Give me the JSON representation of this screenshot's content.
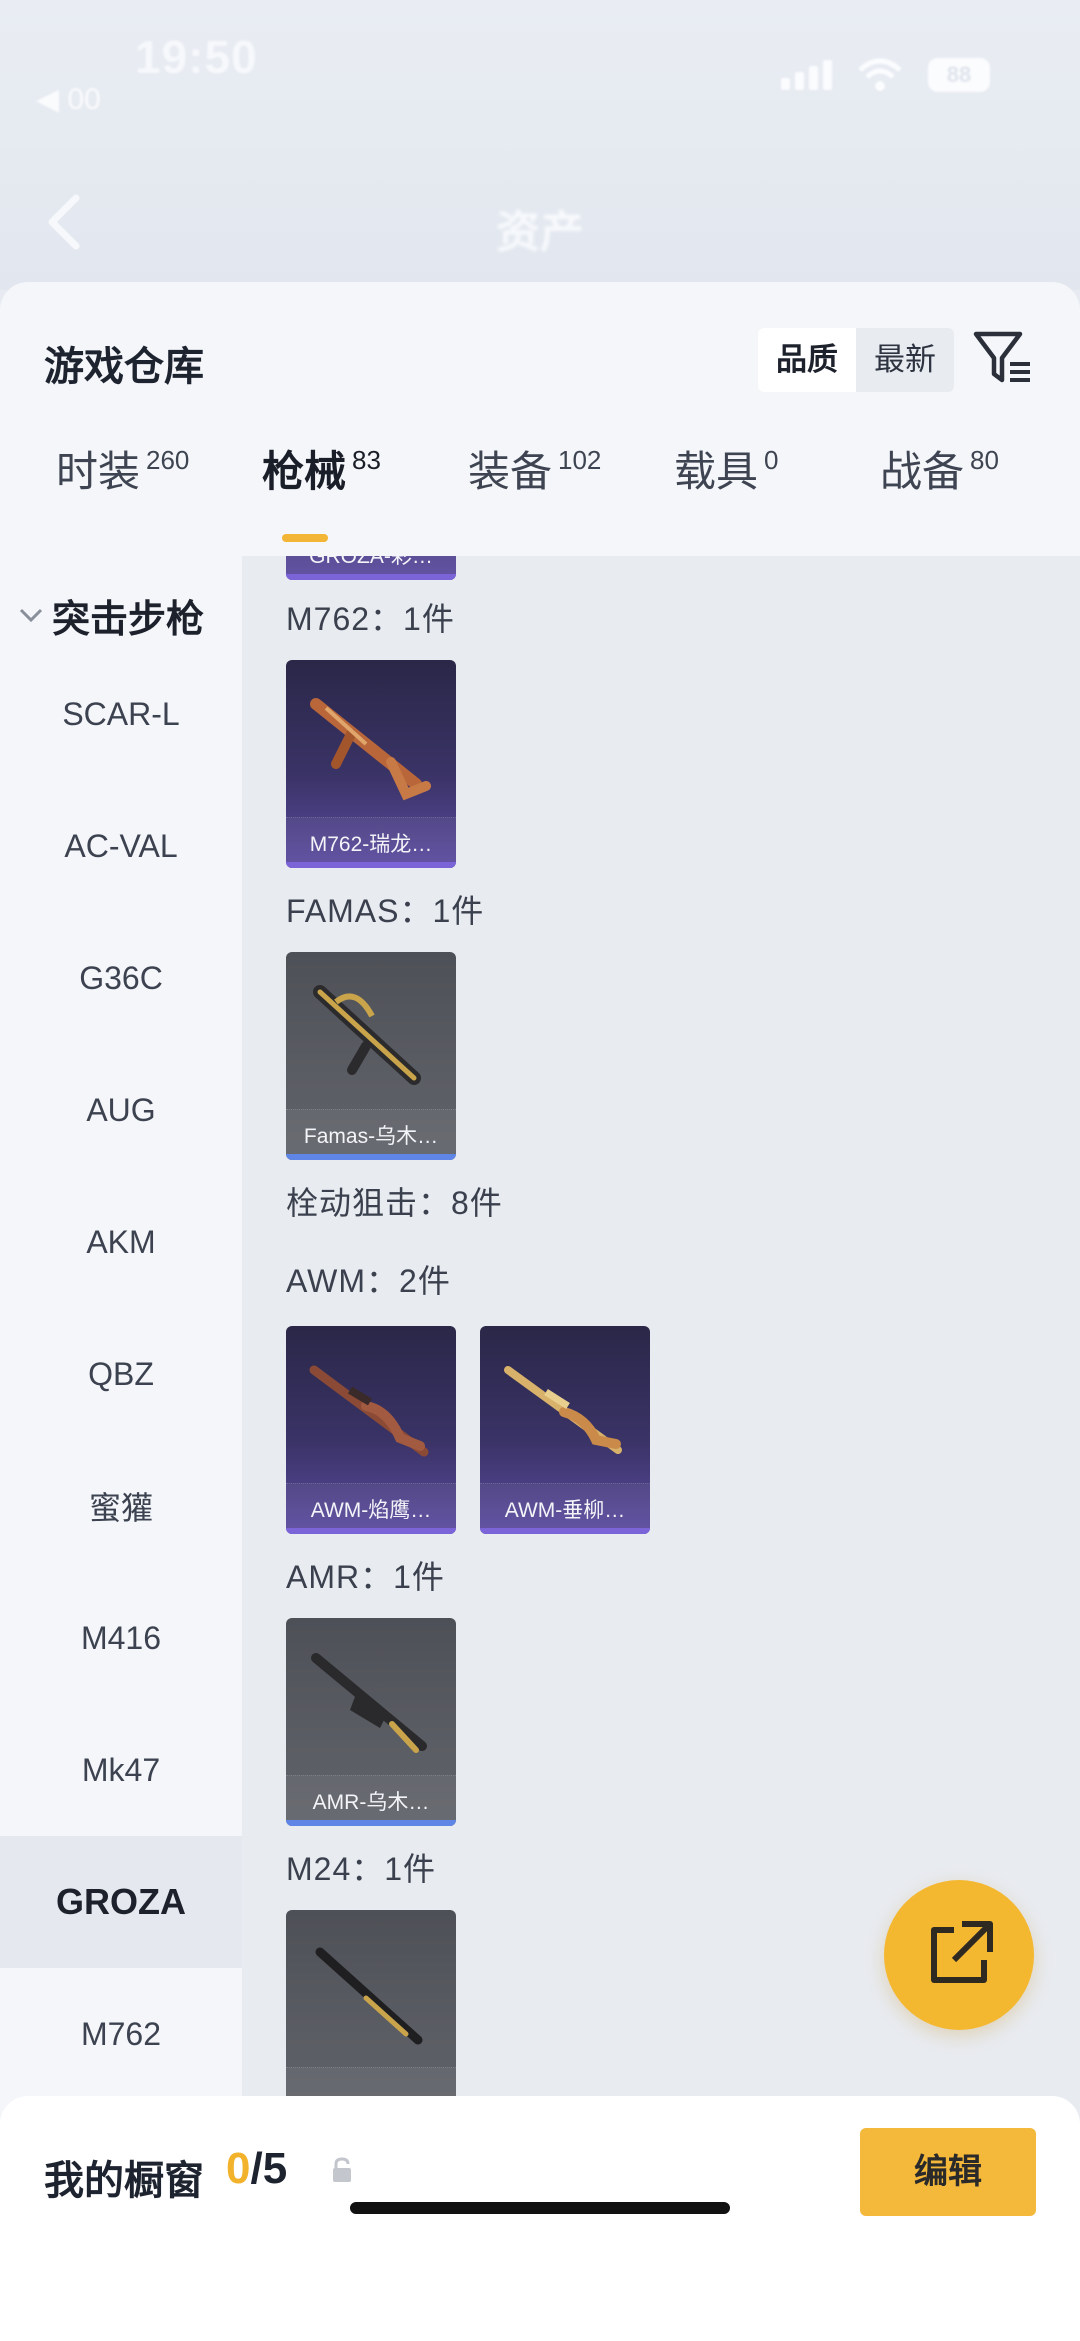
{
  "status": {
    "time": "19:50",
    "sub": "◀ 00",
    "battery": "88"
  },
  "header": {
    "title": "资产"
  },
  "sheet": {
    "title": "游戏仓库",
    "sort": {
      "quality": "品质",
      "newest": "最新"
    }
  },
  "tabs": [
    {
      "label": "时装",
      "count": "260"
    },
    {
      "label": "枪械",
      "count": "83"
    },
    {
      "label": "装备",
      "count": "102"
    },
    {
      "label": "载具",
      "count": "0"
    },
    {
      "label": "战备",
      "count": "80"
    }
  ],
  "sidebar": {
    "category": "突击步枪",
    "items": [
      "SCAR-L",
      "AC-VAL",
      "G36C",
      "AUG",
      "AKM",
      "QBZ",
      "蜜獾",
      "M416",
      "Mk47",
      "GROZA",
      "M762"
    ]
  },
  "content": {
    "top_card_name": "GROZA-彩…",
    "groups": [
      {
        "label": "M762：1件",
        "cards": [
          "M762-瑞龙…"
        ]
      },
      {
        "label": "FAMAS：1件",
        "cards": [
          "Famas-乌木…"
        ]
      },
      {
        "label": "栓动狙击：8件"
      },
      {
        "label": "AWM：2件",
        "cards": [
          "AWM-焰鹰…",
          "AWM-垂柳…"
        ]
      },
      {
        "label": "AMR：1件",
        "cards": [
          "AMR-乌木…"
        ]
      },
      {
        "label": "M24：1件",
        "cards": [
          ""
        ]
      }
    ]
  },
  "bottom": {
    "title": "我的橱窗",
    "current": "0",
    "total": "/5",
    "edit_label": "编辑"
  },
  "colors": {
    "accent": "#f4b730",
    "purple_card": "#3a3366",
    "grey_card": "#5b5d64"
  }
}
